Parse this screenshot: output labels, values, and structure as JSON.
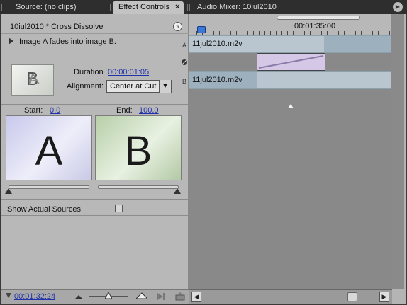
{
  "tabs": [
    {
      "label": "Source: (no clips)",
      "active": false
    },
    {
      "label": "Effect Controls",
      "active": true,
      "close": "×"
    },
    {
      "label": "Audio Mixer: 10iul2010",
      "active": false
    }
  ],
  "panel_menu_icon": "panel-menu-icon",
  "effect": {
    "title": "10iul2010 * Cross Dissolve",
    "description": "Image A fades into image B.",
    "duration_label": "Duration",
    "duration_value": "00:00:01:05",
    "alignment_label": "Alignment:",
    "alignment_value": "Center at Cut",
    "start_label": "Start:",
    "start_value": "0,0",
    "end_label": "End:",
    "end_value": "100,0",
    "letter_a": "A",
    "letter_b": "B",
    "show_sources_label": "Show Actual Sources",
    "show_sources_checked": false,
    "current_time": "00:01:32:24"
  },
  "timeline": {
    "timecode": "00:01:35:00",
    "track_a_clip": "11jul2010.m2v",
    "track_b_clip": "11jul2010.m2v",
    "label_a": "A",
    "label_b": "B"
  },
  "colors": {
    "accent_link": "#2233aa",
    "playhead": "#d23030",
    "transition": "#d5c8e6",
    "track": "#bac6cf"
  }
}
